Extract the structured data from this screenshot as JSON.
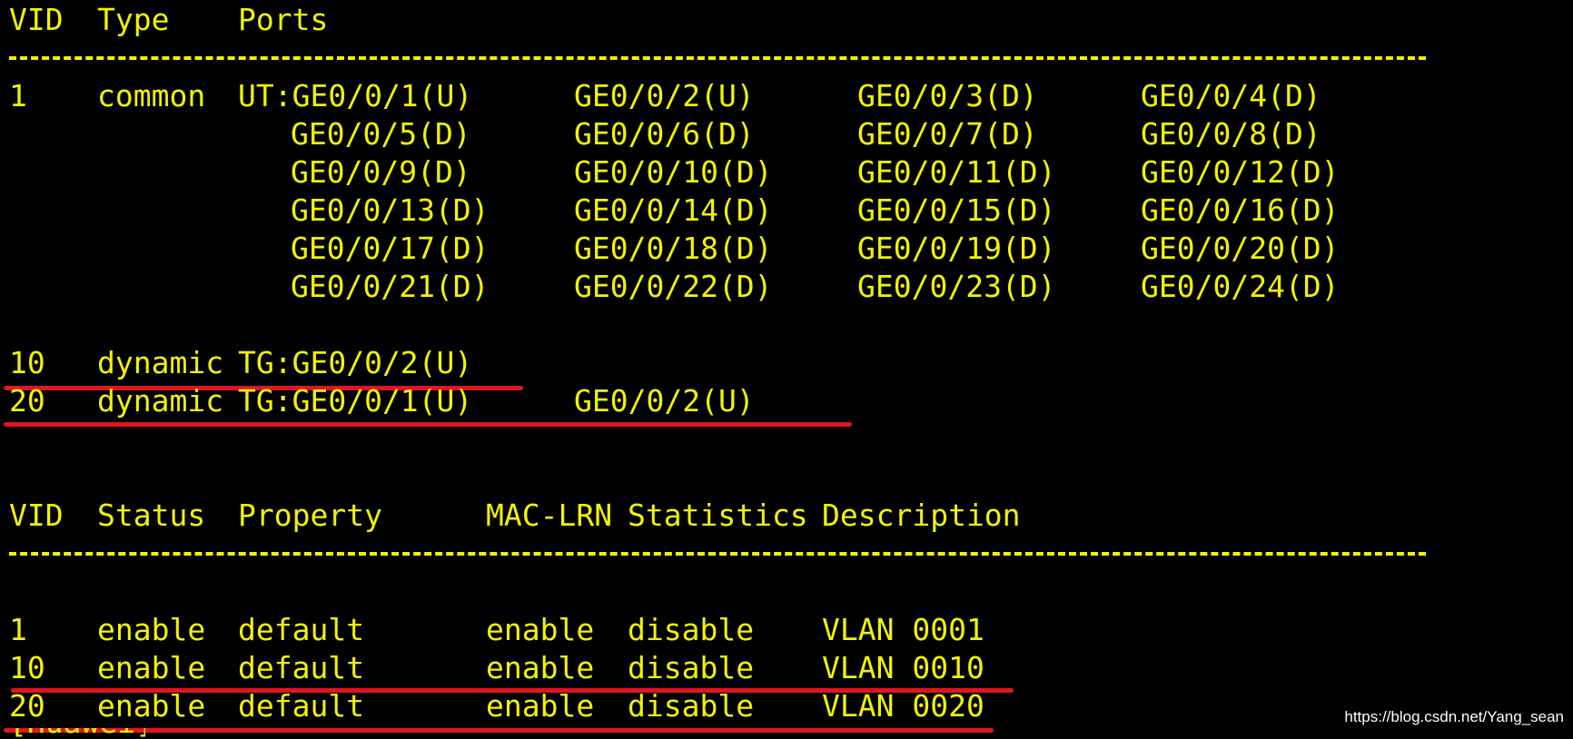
{
  "colors": {
    "background": "#000000",
    "text": "#f2f205",
    "highlight": "#e0161e",
    "watermark": "#ffffff"
  },
  "table1": {
    "headers": {
      "vid": "VID",
      "type": "Type",
      "ports": "Ports"
    },
    "rows": [
      {
        "vid": "1",
        "type": "common",
        "ports": [
          "UT:GE0/0/1(U)",
          "GE0/0/2(U)",
          "GE0/0/3(D)",
          "GE0/0/4(D)"
        ]
      },
      {
        "vid": "",
        "type": "",
        "ports": [
          "GE0/0/5(D)",
          "GE0/0/6(D)",
          "GE0/0/7(D)",
          "GE0/0/8(D)"
        ]
      },
      {
        "vid": "",
        "type": "",
        "ports": [
          "GE0/0/9(D)",
          "GE0/0/10(D)",
          "GE0/0/11(D)",
          "GE0/0/12(D)"
        ]
      },
      {
        "vid": "",
        "type": "",
        "ports": [
          "GE0/0/13(D)",
          "GE0/0/14(D)",
          "GE0/0/15(D)",
          "GE0/0/16(D)"
        ]
      },
      {
        "vid": "",
        "type": "",
        "ports": [
          "GE0/0/17(D)",
          "GE0/0/18(D)",
          "GE0/0/19(D)",
          "GE0/0/20(D)"
        ]
      },
      {
        "vid": "",
        "type": "",
        "ports": [
          "GE0/0/21(D)",
          "GE0/0/22(D)",
          "GE0/0/23(D)",
          "GE0/0/24(D)"
        ]
      },
      {
        "vid": "10",
        "type": "dynamic",
        "ports": [
          "TG:GE0/0/2(U)"
        ]
      },
      {
        "vid": "20",
        "type": "dynamic",
        "ports": [
          "TG:GE0/0/1(U)",
          "GE0/0/2(U)"
        ]
      }
    ]
  },
  "table2": {
    "headers": {
      "vid": "VID",
      "status": "Status",
      "property": "Property",
      "mac_lrn": "MAC-LRN",
      "statistics": "Statistics",
      "description": "Description"
    },
    "rows": [
      {
        "vid": "1",
        "status": "enable",
        "property": "default",
        "mac_lrn": "enable",
        "statistics": "disable",
        "description": "VLAN 0001"
      },
      {
        "vid": "10",
        "status": "enable",
        "property": "default",
        "mac_lrn": "enable",
        "statistics": "disable",
        "description": "VLAN 0010"
      },
      {
        "vid": "20",
        "status": "enable",
        "property": "default",
        "mac_lrn": "enable",
        "statistics": "disable",
        "description": "VLAN 0020"
      }
    ]
  },
  "prompt_fragment": "[Huawei]",
  "watermark": "https://blog.csdn.net/Yang_sean"
}
